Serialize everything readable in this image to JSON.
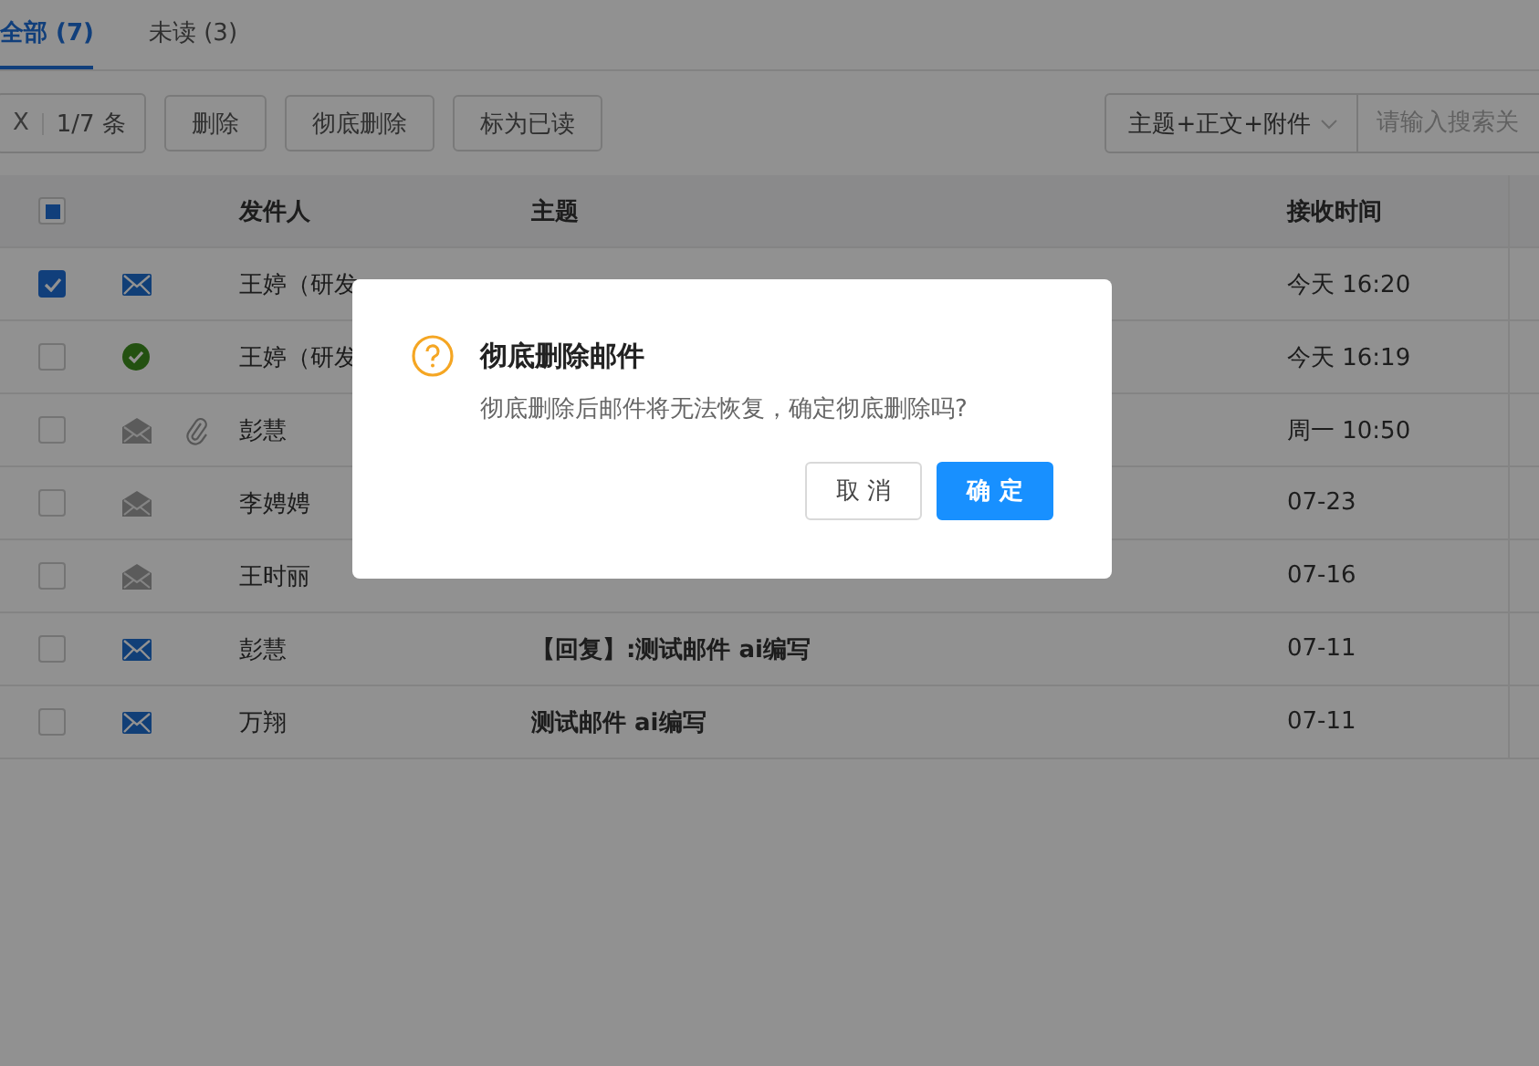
{
  "tabs": [
    {
      "label": "全部 (7)",
      "selected": true
    },
    {
      "label": "未读 (3)",
      "selected": false
    }
  ],
  "toolbar": {
    "clear": "X",
    "count": "1/7 条",
    "buttons": [
      "删除",
      "彻底删除",
      "标为已读"
    ],
    "search_scope": "主题+正文+附件",
    "search": {
      "placeholder": "请输入搜索关"
    }
  },
  "table": {
    "select_all": {
      "indeterminate": true
    },
    "columns": [
      "发件人",
      "主题",
      "接收时间"
    ],
    "rows": [
      {
        "checked": true,
        "kind": "unread",
        "attachment": false,
        "sender": "王婷（研发",
        "subject": "",
        "time": "今天 16:20"
      },
      {
        "checked": false,
        "kind": "replied",
        "attachment": false,
        "sender": "王婷（研发",
        "subject": "",
        "time": "今天 16:19"
      },
      {
        "checked": false,
        "kind": "read",
        "attachment": true,
        "sender": "彭慧",
        "subject": "",
        "time": "周一 10:50"
      },
      {
        "checked": false,
        "kind": "read",
        "attachment": false,
        "sender": "李娉娉",
        "subject": "",
        "time": "07-23"
      },
      {
        "checked": false,
        "kind": "read",
        "attachment": false,
        "sender": "王时丽",
        "subject": "",
        "time": "07-16"
      },
      {
        "checked": false,
        "kind": "unread",
        "attachment": false,
        "sender": "彭慧",
        "subject": "【回复】:测试邮件 ai编写",
        "time": "07-11"
      },
      {
        "checked": false,
        "kind": "unread",
        "attachment": false,
        "sender": "万翔",
        "subject": "测试邮件 ai编写",
        "time": "07-11"
      }
    ]
  },
  "dialog": {
    "title": "彻底删除邮件",
    "message": "彻底删除后邮件将无法恢复，确定彻底删除吗?",
    "buttons": [
      {
        "label": "取 消",
        "kind": "secondary"
      },
      {
        "label": "确 定",
        "kind": "primary"
      }
    ]
  }
}
